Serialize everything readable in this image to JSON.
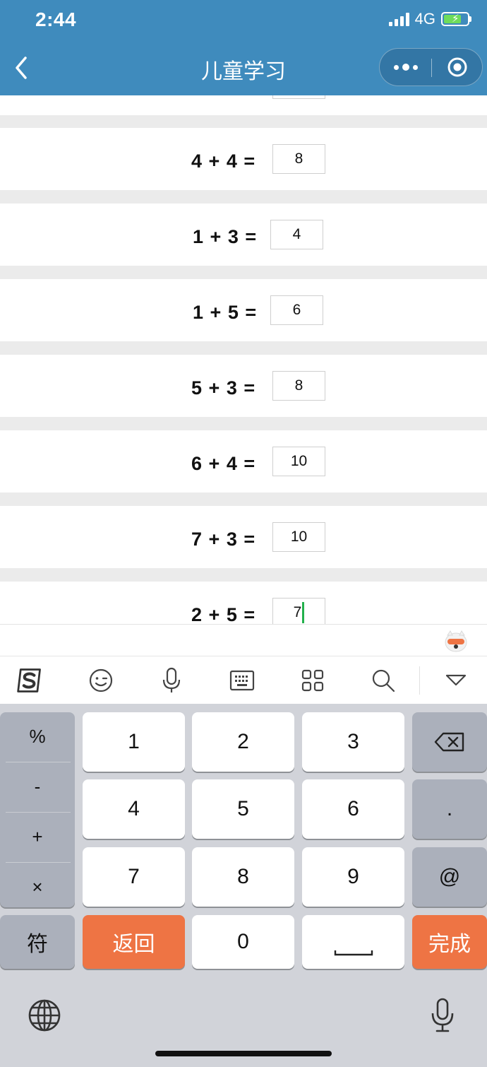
{
  "status": {
    "time": "2:44",
    "network": "4G"
  },
  "header": {
    "title": "儿童学习"
  },
  "problems": [
    {
      "a": "4",
      "b": "4",
      "answer": "8"
    },
    {
      "a": "1",
      "b": "3",
      "answer": "4"
    },
    {
      "a": "1",
      "b": "5",
      "answer": "6"
    },
    {
      "a": "5",
      "b": "3",
      "answer": "8"
    },
    {
      "a": "6",
      "b": "4",
      "answer": "10"
    },
    {
      "a": "7",
      "b": "3",
      "answer": "10"
    },
    {
      "a": "2",
      "b": "5",
      "answer": "7"
    }
  ],
  "operators": {
    "plus": "+",
    "equals": "="
  },
  "toolbar": {
    "icons": [
      "sogou-logo-icon",
      "emoji-icon",
      "microphone-icon",
      "keyboard-icon",
      "grid-icon",
      "search-icon",
      "collapse-keyboard-icon"
    ]
  },
  "keyboard": {
    "symbols": [
      "%",
      "-",
      "+",
      "×"
    ],
    "digits": [
      "1",
      "2",
      "3",
      "4",
      "5",
      "6",
      "7",
      "8",
      "9",
      "0"
    ],
    "dot": ".",
    "at": "@",
    "fu": "符",
    "back": "返回",
    "done": "完成"
  },
  "colors": {
    "header": "#3f8bbd",
    "accent": "#ee7444",
    "cursor": "#22b14c"
  }
}
